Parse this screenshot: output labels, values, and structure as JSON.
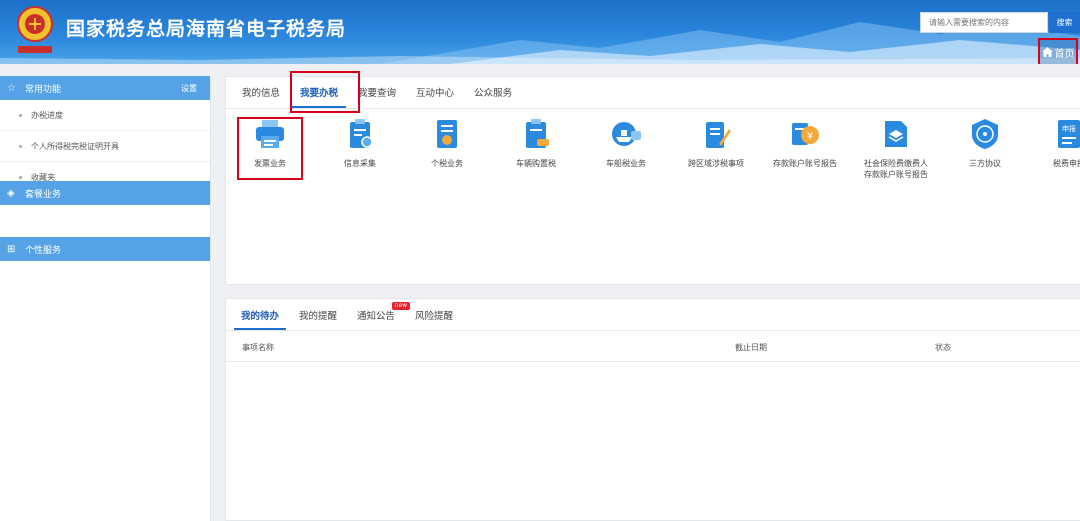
{
  "header": {
    "site_title": "国家税务总局海南省电子税务局",
    "search_placeholder": "请输入需要搜索的内容",
    "search_button": "搜索",
    "home_link": "首页"
  },
  "sidebar": {
    "common": {
      "title": "常用功能",
      "settings": "设置",
      "items": [
        {
          "label": "办税进度"
        },
        {
          "label": "个人所得税完税证明开具"
        },
        {
          "label": "收藏夹"
        }
      ]
    },
    "package": {
      "title": "套餐业务"
    },
    "personal": {
      "title": "个性服务"
    }
  },
  "top_tabs": [
    {
      "label": "我的信息",
      "active": false
    },
    {
      "label": "我要办税",
      "active": true
    },
    {
      "label": "我要查询",
      "active": false
    },
    {
      "label": "互动中心",
      "active": false
    },
    {
      "label": "公众服务",
      "active": false
    }
  ],
  "services": [
    {
      "label": "发票业务",
      "icon": "printer-icon"
    },
    {
      "label": "信息采集",
      "icon": "clipboard-icon"
    },
    {
      "label": "个税业务",
      "icon": "document-star-icon"
    },
    {
      "label": "车辆购置税",
      "icon": "car-clipboard-icon"
    },
    {
      "label": "车船税业务",
      "icon": "ship-icon"
    },
    {
      "label": "跨区域涉税事项",
      "icon": "edit-document-icon"
    },
    {
      "label": "存款账户账号报告",
      "icon": "yuan-coin-icon"
    },
    {
      "label": "社会保险费缴费人",
      "label2": "存款账户账号报告",
      "icon": "layers-folder-icon"
    },
    {
      "label": "三方协议",
      "icon": "agreement-shield-icon"
    },
    {
      "label": "税费申报",
      "icon": "declare-icon",
      "badge": "申报"
    }
  ],
  "bottom_tabs": [
    {
      "label": "我的待办",
      "active": true
    },
    {
      "label": "我的提醒",
      "active": false
    },
    {
      "label": "通知公告",
      "active": false,
      "badge": "new"
    },
    {
      "label": "风险提醒",
      "active": false
    }
  ],
  "table": {
    "columns": [
      "事项名称",
      "截止日期",
      "状态"
    ]
  },
  "colors": {
    "brand": "#1f6fd0",
    "sidebar_head": "#55a3e6",
    "highlight": "#d9001b",
    "icon_blue": "#2a8ae0"
  }
}
